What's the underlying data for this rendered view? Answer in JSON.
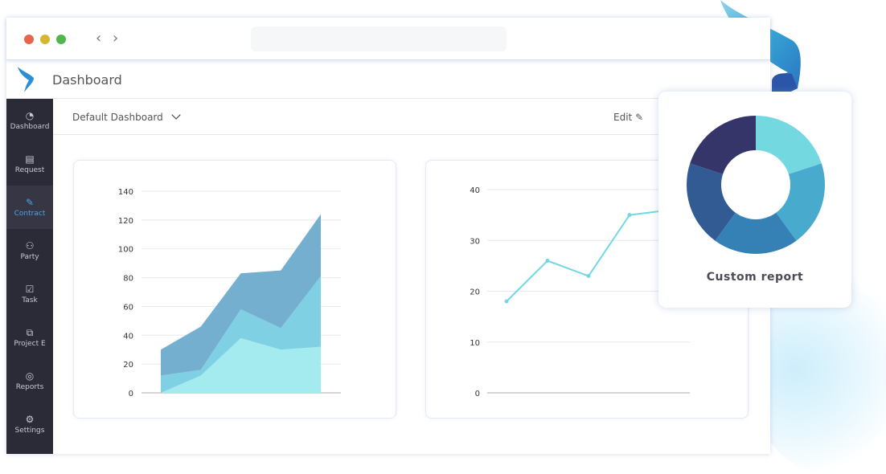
{
  "window": {
    "controls": [
      "close",
      "minimize",
      "maximize"
    ],
    "colors": {
      "close": "#e5664f",
      "minimize": "#d6b731",
      "maximize": "#53b550"
    }
  },
  "header": {
    "title": "Dashboard"
  },
  "sidebar": {
    "items": [
      {
        "label": "Dashboard",
        "icon": "gauge-icon"
      },
      {
        "label": "Request",
        "icon": "chat-icon"
      },
      {
        "label": "Contract",
        "icon": "contract-icon",
        "active": true
      },
      {
        "label": "Party",
        "icon": "party-icon"
      },
      {
        "label": "Task",
        "icon": "checkbox-icon"
      },
      {
        "label": "Project E",
        "icon": "project-icon"
      },
      {
        "label": "Reports",
        "icon": "reports-icon"
      },
      {
        "label": "Settings",
        "icon": "gear-icon"
      }
    ]
  },
  "toolbar": {
    "dashboard_select": "Default Dashboard",
    "edit_label": "Edit"
  },
  "chart_data": [
    {
      "type": "area",
      "stacked": true,
      "x": [
        1,
        2,
        3,
        4,
        5
      ],
      "ylim": [
        0,
        140
      ],
      "yticks": [
        0,
        20,
        40,
        60,
        80,
        100,
        120,
        140
      ],
      "grid": true,
      "series": [
        {
          "values": [
            0,
            12,
            38,
            30,
            32
          ],
          "color": "#9eeaee"
        },
        {
          "values": [
            12,
            4,
            20,
            15,
            49
          ],
          "color": "#78cde2"
        },
        {
          "values": [
            18,
            30,
            25,
            40,
            43
          ],
          "color": "#6eabcd"
        }
      ]
    },
    {
      "type": "line",
      "x": [
        1,
        2,
        3,
        4,
        5
      ],
      "ylim": [
        0,
        40
      ],
      "yticks": [
        0,
        10,
        20,
        30,
        40
      ],
      "grid": true,
      "series": [
        {
          "values": [
            18,
            26,
            23,
            35,
            36
          ],
          "color": "#6fd8e0"
        }
      ]
    },
    {
      "type": "pie",
      "donut": true,
      "title": "Custom report",
      "values": [
        20,
        20,
        20,
        20,
        20
      ],
      "colors": [
        "#74d8e0",
        "#48aacd",
        "#3581b6",
        "#325b94",
        "#35356a"
      ]
    }
  ]
}
